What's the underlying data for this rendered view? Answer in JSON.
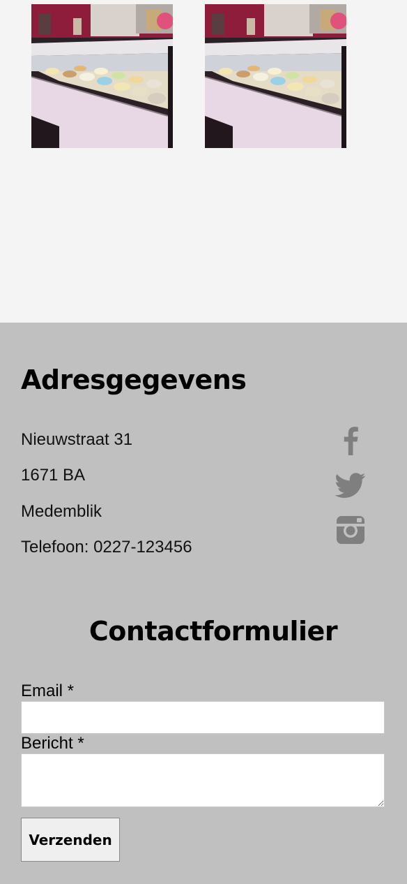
{
  "gallery": {
    "images": [
      {
        "name": "ice-cream-display-photo"
      },
      {
        "name": "ice-cream-display-photo"
      }
    ]
  },
  "address": {
    "title": "Adresgegevens",
    "street": "Nieuwstraat 31",
    "postal_code": "1671 BA",
    "city": "Medemblik",
    "phone": "Telefoon: 0227-123456"
  },
  "social": {
    "icons": [
      "facebook-icon",
      "twitter-icon",
      "instagram-icon"
    ],
    "color": "#7f7f7f"
  },
  "contact_form": {
    "title": "Contactformulier",
    "email_label": "Email *",
    "email_value": "",
    "message_label": "Bericht *",
    "message_value": "",
    "submit_label": "Verzenden"
  },
  "colors": {
    "page_background": "#f4f4f4",
    "footer_background": "#c0c0c0",
    "photo_accent": "#8e1d3c"
  }
}
